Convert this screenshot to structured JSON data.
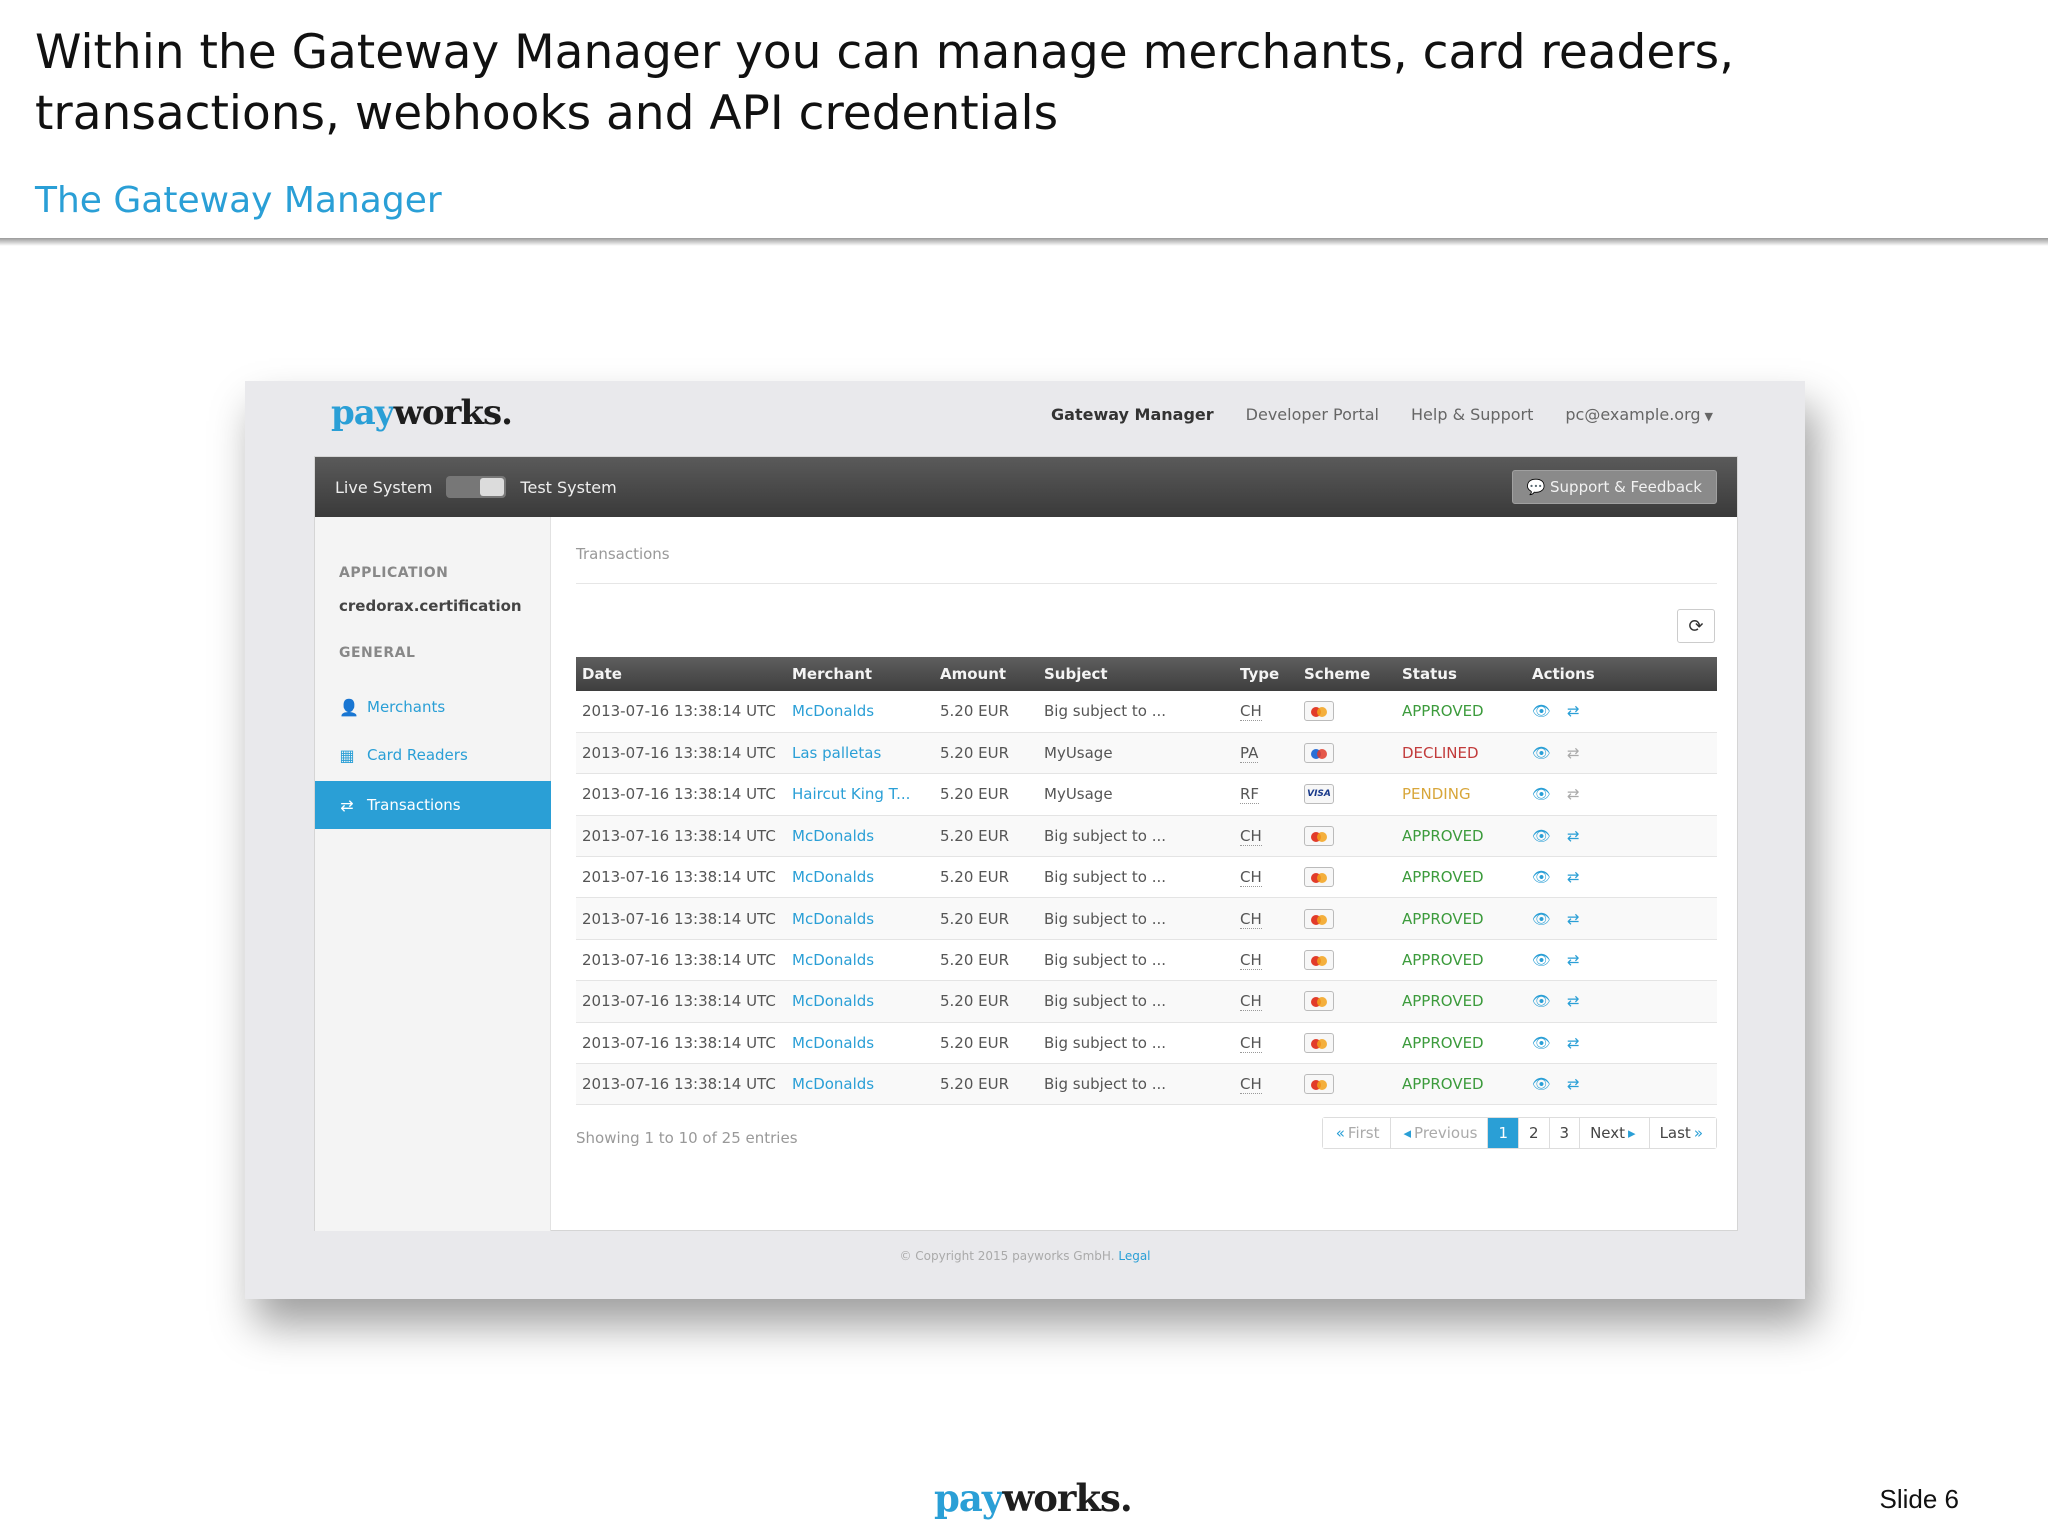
{
  "slide": {
    "title": "Within the Gateway Manager you can manage merchants, card readers, transactions, webhooks and API credentials",
    "subtitle": "The Gateway Manager",
    "number": "Slide 6"
  },
  "brand": {
    "pay": "pay",
    "works": "works."
  },
  "topnav": {
    "gateway_manager": "Gateway Manager",
    "developer_portal": "Developer Portal",
    "help_support": "Help & Support",
    "account": "pc@example.org"
  },
  "darkbar": {
    "live": "Live System",
    "test": "Test System",
    "support": "Support & Feedback"
  },
  "sidebar": {
    "application_heading": "APPLICATION",
    "application_name": "credorax.certification",
    "general_heading": "GENERAL",
    "items": [
      {
        "label": "Merchants",
        "icon": "user-icon"
      },
      {
        "label": "Card Readers",
        "icon": "calculator-icon"
      },
      {
        "label": "Transactions",
        "icon": "exchange-icon"
      }
    ]
  },
  "main": {
    "breadcrumb": "Transactions",
    "columns": [
      "Date",
      "Merchant",
      "Amount",
      "Subject",
      "Type",
      "Scheme",
      "Status",
      "Actions"
    ],
    "rows": [
      {
        "date": "2013-07-16 13:38:14 UTC",
        "merchant": "McDonalds",
        "amount": "5.20 EUR",
        "subject": "Big subject to ...",
        "type": "CH",
        "scheme": "mc",
        "status": "APPROVED"
      },
      {
        "date": "2013-07-16 13:38:14 UTC",
        "merchant": "Las palletas",
        "amount": "5.20 EUR",
        "subject": "MyUsage",
        "type": "PA",
        "scheme": "maestro",
        "status": "DECLINED"
      },
      {
        "date": "2013-07-16 13:38:14 UTC",
        "merchant": "Haircut King T...",
        "amount": "5.20 EUR",
        "subject": "MyUsage",
        "type": "RF",
        "scheme": "visa",
        "status": "PENDING"
      },
      {
        "date": "2013-07-16 13:38:14 UTC",
        "merchant": "McDonalds",
        "amount": "5.20 EUR",
        "subject": "Big subject to ...",
        "type": "CH",
        "scheme": "mc",
        "status": "APPROVED"
      },
      {
        "date": "2013-07-16 13:38:14 UTC",
        "merchant": "McDonalds",
        "amount": "5.20 EUR",
        "subject": "Big subject to ...",
        "type": "CH",
        "scheme": "mc",
        "status": "APPROVED"
      },
      {
        "date": "2013-07-16 13:38:14 UTC",
        "merchant": "McDonalds",
        "amount": "5.20 EUR",
        "subject": "Big subject to ...",
        "type": "CH",
        "scheme": "mc",
        "status": "APPROVED"
      },
      {
        "date": "2013-07-16 13:38:14 UTC",
        "merchant": "McDonalds",
        "amount": "5.20 EUR",
        "subject": "Big subject to ...",
        "type": "CH",
        "scheme": "mc",
        "status": "APPROVED"
      },
      {
        "date": "2013-07-16 13:38:14 UTC",
        "merchant": "McDonalds",
        "amount": "5.20 EUR",
        "subject": "Big subject to ...",
        "type": "CH",
        "scheme": "mc",
        "status": "APPROVED"
      },
      {
        "date": "2013-07-16 13:38:14 UTC",
        "merchant": "McDonalds",
        "amount": "5.20 EUR",
        "subject": "Big subject to ...",
        "type": "CH",
        "scheme": "mc",
        "status": "APPROVED"
      },
      {
        "date": "2013-07-16 13:38:14 UTC",
        "merchant": "McDonalds",
        "amount": "5.20 EUR",
        "subject": "Big subject to ...",
        "type": "CH",
        "scheme": "mc",
        "status": "APPROVED"
      }
    ],
    "showing": "Showing 1 to 10 of 25 entries",
    "pagination": {
      "first": "First",
      "previous": "Previous",
      "pages": [
        "1",
        "2",
        "3"
      ],
      "current": "1",
      "next": "Next",
      "last": "Last"
    }
  },
  "copyright": {
    "text": "© Copyright 2015 payworks GmbH.",
    "legal": "Legal"
  },
  "colors": {
    "accent": "#2a9fd6",
    "approved": "#3c9b3c",
    "declined": "#c23b3b",
    "pending": "#d8a63a"
  }
}
